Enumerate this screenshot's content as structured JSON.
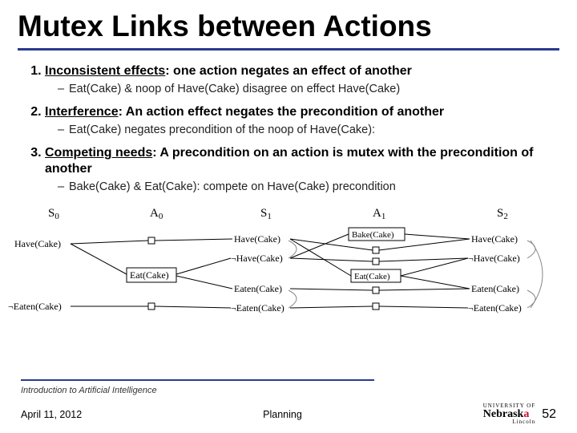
{
  "title": "Mutex Links between Actions",
  "items": [
    {
      "num": "1.",
      "term": "Inconsistent effects",
      "rest": ": one action negates an effect of another",
      "sub": "Eat(Cake) & noop of Have(Cake) disagree on effect Have(Cake)"
    },
    {
      "num": "2.",
      "term": "Interference",
      "rest": ": An action effect negates the precondition of another",
      "sub": "Eat(Cake) negates precondition of the noop of Have(Cake):"
    },
    {
      "num": "3.",
      "term": "Competing needs",
      "rest": ": A precondition on an action is mutex with the precondition of another",
      "sub": "Bake(Cake) & Eat(Cake): compete on Have(Cake) precondition"
    }
  ],
  "diagram": {
    "columns": [
      "S",
      "A",
      "S",
      "A",
      "S"
    ],
    "col_subs": [
      "0",
      "0",
      "1",
      "1",
      "2"
    ],
    "s0": [
      "Have(Cake)",
      "¬Eaten(Cake)"
    ],
    "a0": [
      "Eat(Cake)"
    ],
    "s1": [
      "Have(Cake)",
      "¬Have(Cake)",
      "Eaten(Cake)",
      "¬Eaten(Cake)"
    ],
    "a1": [
      "Bake(Cake)",
      "Eat(Cake)"
    ],
    "s2": [
      "Have(Cake)",
      "¬Have(Cake)",
      "Eaten(Cake)",
      "¬Eaten(Cake)"
    ]
  },
  "footer": {
    "course": "Introduction to Artificial Intelligence",
    "date": "April 11, 2012",
    "topic": "Planning",
    "page": "52",
    "logo_top": "UNIVERSITY OF",
    "logo_main1": "Nebrask",
    "logo_main2": "a",
    "logo_sub": "Lincoln"
  }
}
